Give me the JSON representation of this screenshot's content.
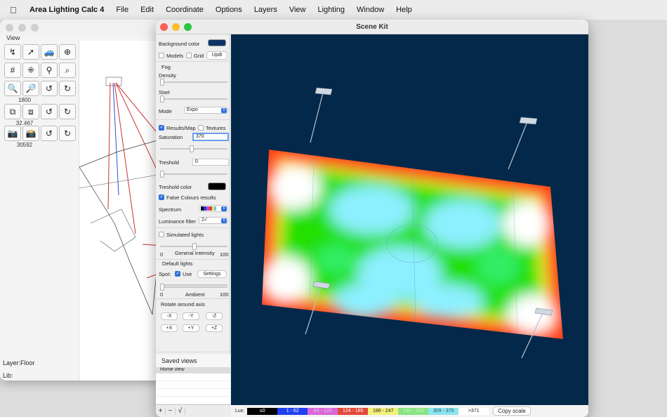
{
  "menubar": {
    "app_name": "Area Lighting Calc 4",
    "items": [
      "File",
      "Edit",
      "Coordinate",
      "Options",
      "Layers",
      "View",
      "Lighting",
      "Window",
      "Help"
    ]
  },
  "back_window": {
    "view_label": "View",
    "numbers": [
      "1800",
      "32.467",
      "30592"
    ],
    "layer_label": "Layer:Floor",
    "lib_label": "Lib:"
  },
  "scene_window": {
    "title": "Scene Kit",
    "sidebar": {
      "background_color_label": "Background color",
      "background_color": "#0d3564",
      "models_label": "Models",
      "grid_label": "Grid",
      "updt_label": "Updt",
      "fog_label": "Fog",
      "density_label": "Density",
      "start_label": "Start",
      "mode_label": "Mode",
      "mode_value": "Expo",
      "results_map_label": "Results/Map",
      "textures_label": "Textures",
      "saturation_label": "Saturation",
      "saturation_value": "370",
      "treshold_label": "Treshold",
      "treshold_value": "0",
      "treshold_color_label": "Treshold color",
      "treshold_color": "#000000",
      "false_colours_label": "False Colours results",
      "spectrum_label": "Spectrum",
      "luminance_filter_label": "Luminance filter",
      "luminance_filter_value": "2√",
      "simulated_lights_label": "Simulated lights",
      "general_min": "0",
      "general_label": "General Intensity",
      "general_max": "100",
      "default_lights_label": "Default lights",
      "spot_label": "Spot:",
      "use_label": "Use",
      "settings_label": "Settings",
      "ambient_min": "0",
      "ambient_label": "Ambient",
      "ambient_max": "100",
      "rotate_label": "Rotate around axis",
      "rotate_buttons": [
        "-X",
        "-Y",
        "-Z",
        "+X",
        "+Y",
        "+Z"
      ],
      "saved_views_label": "Saved views",
      "saved_views": [
        "Home view"
      ],
      "bottom_buttons": [
        "+",
        "−",
        "√"
      ]
    },
    "legend": {
      "lux_label": "Lux:",
      "ranges": [
        {
          "label": "≤0",
          "bg": "#000000",
          "fg": "#ffffff"
        },
        {
          "label": "1 - 62",
          "bg": "#1f3ff0",
          "fg": "#ffffff"
        },
        {
          "label": "63 - 123",
          "bg": "#d867d8",
          "fg": "#f2c2f2"
        },
        {
          "label": "124 - 185",
          "bg": "#e2483a",
          "fg": "#ffffff"
        },
        {
          "label": "186 - 247",
          "bg": "#f3f07a",
          "fg": "#222222"
        },
        {
          "label": "248 - 308",
          "bg": "#88e37f",
          "fg": "#c4f5bf"
        },
        {
          "label": "309 - 370",
          "bg": "#8ce6ef",
          "fg": "#2b4e6a"
        },
        {
          "label": ">371",
          "bg": "#ffffff",
          "fg": "#222222"
        }
      ],
      "copy_scale_label": "Copy scale"
    }
  }
}
